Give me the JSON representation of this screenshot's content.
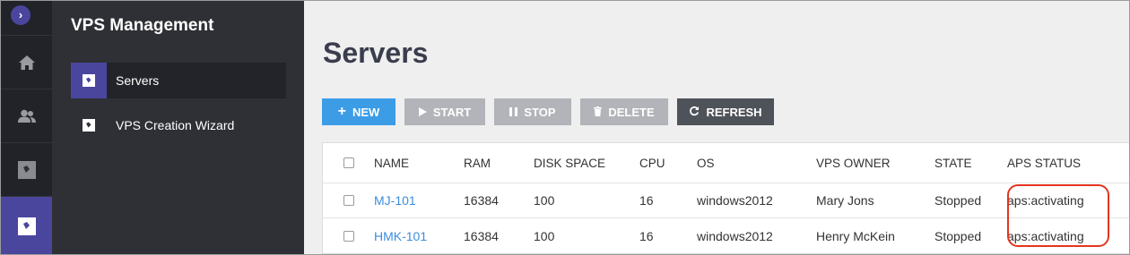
{
  "rail": {
    "toggle_glyph": "›",
    "items": [
      {
        "icon": "home-icon"
      },
      {
        "icon": "users-icon"
      },
      {
        "icon": "app-icon"
      },
      {
        "icon": "app-icon-active"
      }
    ]
  },
  "sidebar": {
    "title": "VPS Management",
    "items": [
      {
        "label": "Servers"
      },
      {
        "label": "VPS Creation Wizard"
      }
    ]
  },
  "main": {
    "title": "Servers"
  },
  "toolbar": {
    "new_label": "NEW",
    "start_label": "START",
    "stop_label": "STOP",
    "delete_label": "DELETE",
    "refresh_label": "REFRESH"
  },
  "table": {
    "columns": [
      "NAME",
      "RAM",
      "DISK SPACE",
      "CPU",
      "OS",
      "VPS OWNER",
      "STATE",
      "APS STATUS"
    ],
    "rows": [
      {
        "name": "MJ-101",
        "ram": "16384",
        "disk": "100",
        "cpu": "16",
        "os": "windows2012",
        "owner": "Mary Jons",
        "state": "Stopped",
        "aps": "aps:activating"
      },
      {
        "name": "HMK-101",
        "ram": "16384",
        "disk": "100",
        "cpu": "16",
        "os": "windows2012",
        "owner": "Henry McKein",
        "state": "Stopped",
        "aps": "aps:activating"
      }
    ]
  },
  "colors": {
    "accent": "#4a469e",
    "primary_button": "#3c9ce6",
    "highlight": "#e3351f"
  }
}
